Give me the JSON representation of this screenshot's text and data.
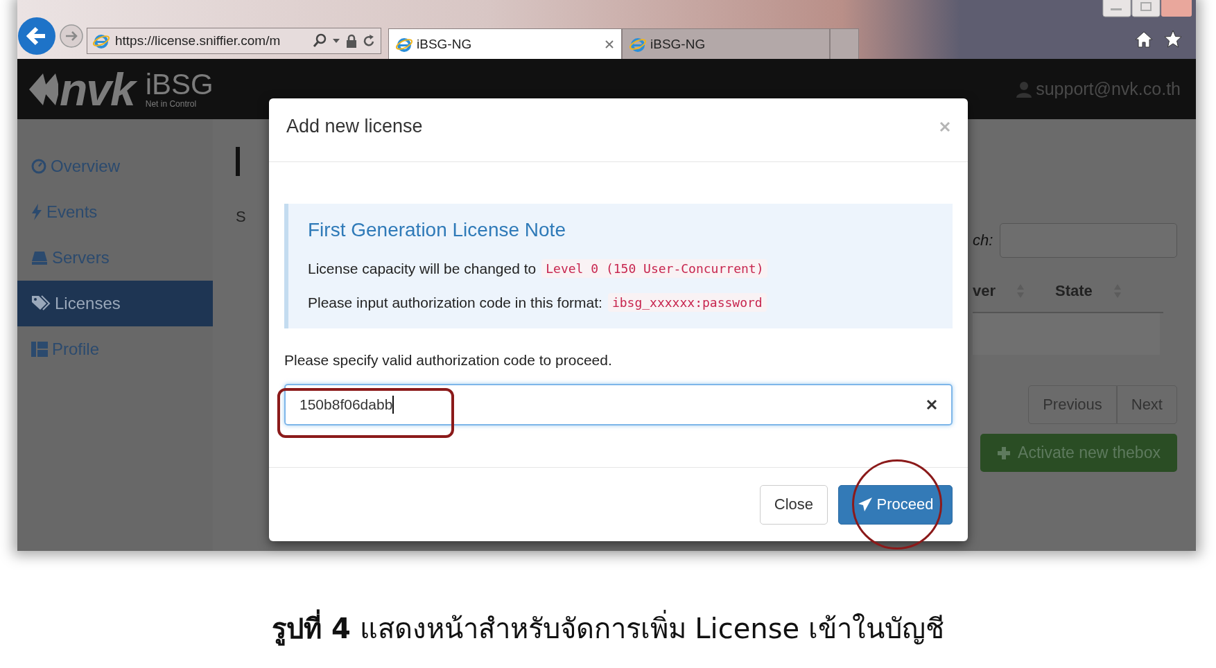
{
  "browser": {
    "address": "https://license.sniffier.com/m",
    "tabs": [
      {
        "title": "iBSG-NG",
        "selected": true
      },
      {
        "title": "iBSG-NG",
        "selected": false
      }
    ]
  },
  "header": {
    "logo_mark": "nvk",
    "logo_name": "iBSG",
    "logo_tagline": "Net in Control",
    "user": "support@nvk.co.th"
  },
  "sidebar": {
    "items": [
      {
        "label": "Overview",
        "selected": false
      },
      {
        "label": "Events",
        "selected": false
      },
      {
        "label": "Servers",
        "selected": false
      },
      {
        "label": "Licenses",
        "selected": true
      },
      {
        "label": "Profile",
        "selected": false
      }
    ]
  },
  "page": {
    "title_fragment": "S",
    "search_label": "ch:",
    "columns": [
      "ver",
      "State"
    ],
    "pagination": [
      "Previous",
      "Next"
    ],
    "activate_button": "Activate new thebox"
  },
  "modal": {
    "title": "Add new license",
    "note": {
      "heading": "First Generation License Note",
      "lines": [
        {
          "text": "License capacity will be changed to",
          "code": "Level 0 (150 User-Concurrent)"
        },
        {
          "text": "Please input authorization code in this format:",
          "code": "ibsg_xxxxxx:password"
        }
      ]
    },
    "prompt": "Please specify valid authorization code to proceed.",
    "input": {
      "value": "150b8f06dabb"
    },
    "buttons": [
      {
        "label": "Close",
        "kind": "default"
      },
      {
        "label": "Proceed",
        "kind": "primary"
      }
    ]
  },
  "highlights": [
    {
      "kind": "rectangle"
    },
    {
      "kind": "circle"
    }
  ],
  "caption": "**รูปที่ 4** แสดงหน้าสำหรับจัดการเพิ่ม License เข้าในบัญชี"
}
